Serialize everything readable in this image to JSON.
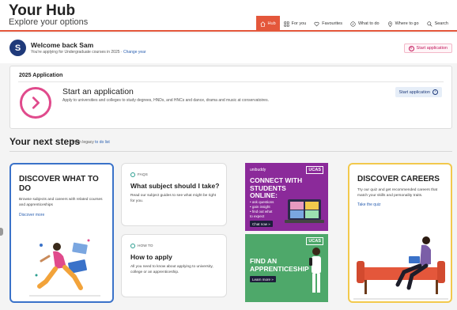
{
  "header": {
    "title": "Your Hub",
    "subtitle": "Explore your options",
    "nav": [
      {
        "label": "Hub",
        "icon": "home-icon",
        "active": true
      },
      {
        "label": "For you",
        "icon": "grid-icon",
        "active": false
      },
      {
        "label": "Favourites",
        "icon": "heart-icon",
        "active": false
      },
      {
        "label": "What to do",
        "icon": "compass-icon",
        "active": false
      },
      {
        "label": "Where to go",
        "icon": "location-pin-icon",
        "active": false
      },
      {
        "label": "Search",
        "icon": "search-icon",
        "active": false
      }
    ],
    "accent_color": "#e4573b"
  },
  "welcome": {
    "avatar_letter": "S",
    "title": "Welcome back Sam",
    "subtitle": "You're applying for Undergraduate courses in 2025 ·",
    "change_year": "Change year",
    "start_button": "Start application"
  },
  "application": {
    "year_title": "2025 Application",
    "title": "Start an application",
    "description": "Apply to universities and colleges to study degrees, HNDs, and HNCs and dance, drama and music at conservatoires.",
    "button": "Start application"
  },
  "next_steps": {
    "title": "Your next steps",
    "link_prefix": "| Open legacy",
    "link": "to do list"
  },
  "cards": {
    "discover": {
      "title": "DISCOVER WHAT TO DO",
      "description": "Browse subjects and careers with related courses and apprenticeships",
      "link": "Discover more"
    },
    "faqs": {
      "tag": "FAQS",
      "title": "What subject should I take?",
      "description": "Read our subject guides to see what might be right for you."
    },
    "howto": {
      "tag": "HOW TO",
      "title": "How to apply",
      "description": "All you need to know about applying to university, college or an apprenticeship."
    },
    "careers": {
      "title": "DISCOVER CAREERS",
      "description": "Try our quiz and get recommended careers that match your skills and personality traits.",
      "link": "Take the quiz"
    }
  },
  "ads": {
    "unibuddy": {
      "brand": "unibuddy",
      "ucas": "UCAS",
      "headline": "CONNECT WITH STUDENTS ONLINE:",
      "bullets": [
        "• ask questions",
        "• gain insight",
        "• find out what",
        "  to expect"
      ],
      "button": "Chat now »",
      "color": "#8b2a9a"
    },
    "apprenticeship": {
      "ucas": "UCAS",
      "headline": "FIND AN APPRENTICESHIP",
      "button": "Learn more »",
      "color": "#4ea86a"
    }
  }
}
